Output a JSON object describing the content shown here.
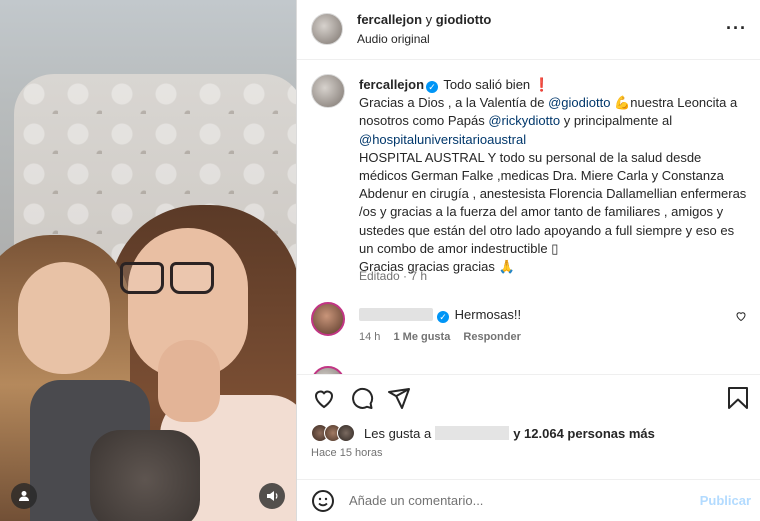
{
  "post": {
    "owner": "fercallejon",
    "owner_joiner": " y ",
    "collaborator": "giodiotto",
    "audio": "Audio original",
    "more_icon": "more-icon"
  },
  "caption": {
    "username": "fercallejon",
    "lines": [
      "Todo salió bien ❗",
      "Gracias a Dios , a la Valentía de",
      "@giodiotto",
      "💪nuestra Leoncita a nosotros como Papás",
      "@rickydiotto",
      "y principalmente al",
      "@hospitaluniversitarioaustral",
      "HOSPITAL AUSTRAL Y todo su personal de la salud desde médicos German Falke ,medicas Dra. Miere Carla y Constanza Abdenur en cirugía , anestesista Florencia Dallamellian enfermeras /os y gracias a la fuerza del amor tanto de familiares , amigos y ustedes que están del otro lado apoyando a full siempre y eso es un combo de amor indestructible ▯",
      "Gracias gracias gracias 🙏"
    ],
    "edited": "Editado · 7 h"
  },
  "comment": {
    "text": "Hermosas!!",
    "time": "14 h",
    "likes": "1 Me gusta",
    "reply": "Responder"
  },
  "likes": {
    "prefix": "Les gusta a",
    "suffix": "y 12.064 personas más"
  },
  "time_ago": "Hace 15 horas",
  "add_comment": {
    "placeholder": "Añade un comentario...",
    "publish": "Publicar"
  }
}
